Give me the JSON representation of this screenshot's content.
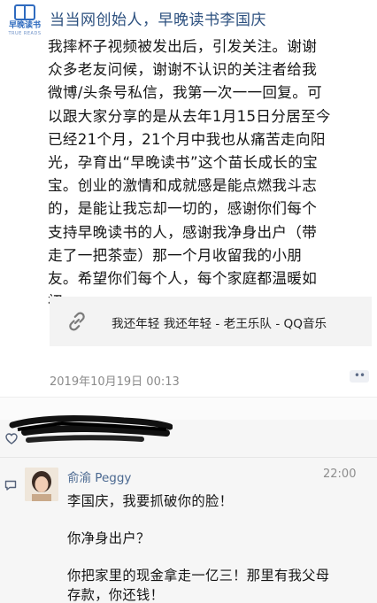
{
  "header": {
    "logo_name": "早晚读书",
    "logo_sub": "TRUE READS",
    "title": "当当网创始人，早晚读书李国庆"
  },
  "post": {
    "lines": [
      "我摔杯子视频被发出后，引发关注。谢谢",
      "众多老友问候，谢谢不认识的关注者给我",
      "微博/头条号私信，我第一次一一回复。可",
      "以跟大家分享的是从去年1月15日分居至今",
      "已经21个月，21个月中我也从痛苦走向阳",
      "光，孕育出“早晚读书”这个苗长成长的宝",
      "宝。创业的激情和成就感是能点燃我斗志",
      "的，是能让我忘却一切的，感谢你们每个",
      "支持早晚读书的人，感谢我净身出户（带",
      "走了一把茶壶）那一个月收留我的小朋",
      "友。希望你们每个人，每个家庭都温暖如",
      "初。"
    ],
    "share_card": {
      "icon": "link-icon",
      "text": "我还年轻 我还年轻 - 老王乐队 - QQ音乐"
    },
    "timestamp": "2019年10月19日 00:13",
    "more_label": "••"
  },
  "comments": {
    "icon": "comment-icon",
    "items": [
      {
        "author": "俞渝 Peggy",
        "time": "22:00",
        "lines": [
          "李国庆，我要抓破你的脸！",
          "你净身出户？",
          "你把家里的现金拿走一亿三！那里有我父母",
          "存款，你还钱！"
        ]
      }
    ]
  },
  "likes": {
    "icon": "heart-icon"
  },
  "colors": {
    "title_blue": "#2b4f7e",
    "name_blue": "#4a6890",
    "card_bg": "#f3f3f3",
    "comment_bg": "#f6f6f6"
  }
}
